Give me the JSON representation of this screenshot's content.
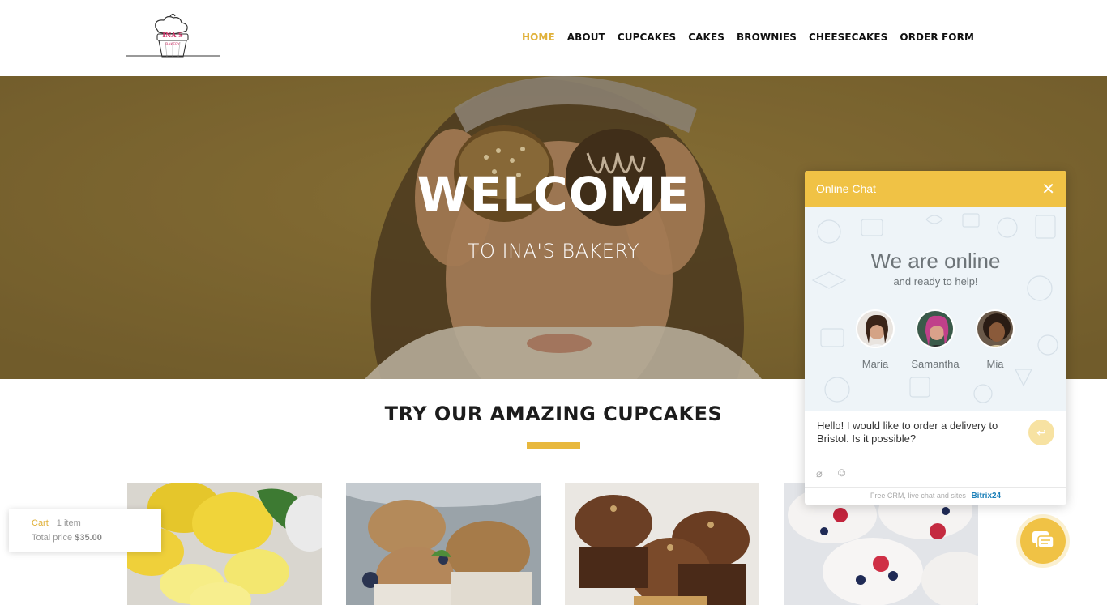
{
  "brand": {
    "logo_text": "INA'S",
    "logo_sub": "BAKERY"
  },
  "nav": {
    "items": [
      {
        "label": "HOME",
        "active": true
      },
      {
        "label": "ABOUT"
      },
      {
        "label": "CUPCAKES"
      },
      {
        "label": "CAKES"
      },
      {
        "label": "BROWNIES"
      },
      {
        "label": "CHEESECAKES"
      },
      {
        "label": "ORDER FORM"
      }
    ]
  },
  "hero": {
    "title": "WELCOME",
    "subtitle": "TO INA'S BAKERY"
  },
  "section": {
    "title": "TRY OUR AMAZING CUPCAKES"
  },
  "products": [
    {
      "image": "lemon-cupcakes"
    },
    {
      "image": "oat-muffins"
    },
    {
      "image": "chocolate-cupcakes"
    },
    {
      "image": "berry-cupcakes"
    }
  ],
  "cart": {
    "label": "Cart",
    "items": "1 item",
    "total_label": "Total price",
    "total_value": "$35.00"
  },
  "chat": {
    "header": "Online Chat",
    "online_title": "We are online",
    "online_sub": "and ready to help!",
    "agents": [
      {
        "name": "Maria"
      },
      {
        "name": "Samantha"
      },
      {
        "name": "Mia"
      }
    ],
    "message": "Hello! I would like to order a delivery to Bristol. Is it possible?",
    "footer_text": "Free CRM, live chat and sites",
    "footer_brand": "Bitrix",
    "footer_brand_num": "24"
  },
  "colors": {
    "accent": "#e8b83d",
    "chat_yellow": "#f0c245",
    "hero_overlay": "#7a6530"
  }
}
